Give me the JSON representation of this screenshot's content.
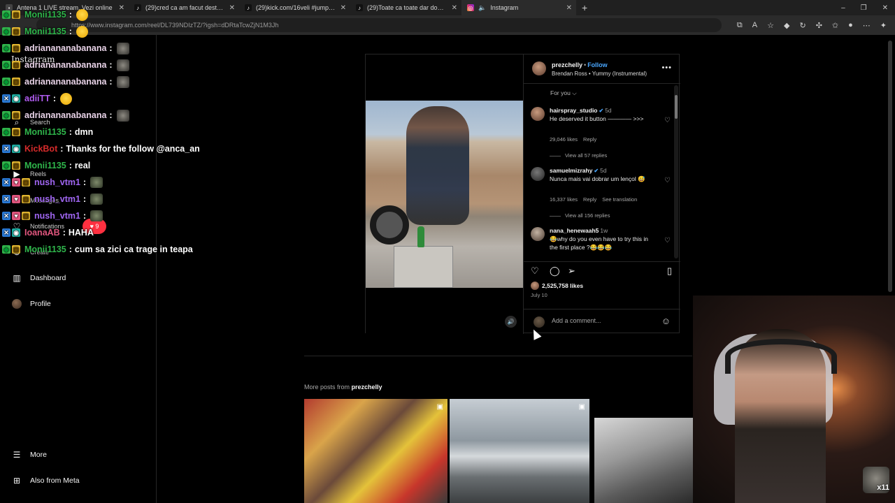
{
  "browser": {
    "tabs": [
      {
        "title": "Antena 1 LIVE stream. Vezi online",
        "icon": "page-icon",
        "active": false
      },
      {
        "title": "(29)cred ca am facut destul de cl",
        "icon": "tiktok-icon",
        "active": false
      },
      {
        "title": "(29)kick.com/16veli #jumpscare #",
        "icon": "tiktok-icon",
        "active": false
      },
      {
        "title": "(29)Toate ca toate dar domnu Jag",
        "icon": "tiktok-icon",
        "active": false
      },
      {
        "title": "Instagram",
        "icon": "instagram-icon",
        "active": true
      }
    ],
    "new_tab": "+",
    "url": "https://www.instagram.com/reel/DL739NDIzTZ/?igsh=dDRtaTcwZjN1M3Jh",
    "window_controls": [
      "–",
      "❐",
      "✕"
    ]
  },
  "sidebar": {
    "logo": "Instagram",
    "items": {
      "search": "Search",
      "reels": "Reels",
      "messages": "Messages",
      "notifications": "Notifications",
      "create": "Create",
      "dashboard": "Dashboard",
      "profile": "Profile",
      "more": "More",
      "also_from_meta": "Also from Meta"
    },
    "notification_badge": "9"
  },
  "chat": [
    {
      "user": "Monii1135",
      "color": "#2fb64b",
      "msg": "",
      "emote": "smile",
      "badges": [
        "green",
        "gold"
      ]
    },
    {
      "user": "Monii1135",
      "color": "#2fb64b",
      "msg": "",
      "emote": "smile",
      "badges": [
        "green",
        "gold"
      ]
    },
    {
      "user": "adrianananabanana",
      "color": "#e9d3e8",
      "msg": "",
      "emote": "monkey",
      "badges": [
        "green",
        "gold"
      ]
    },
    {
      "user": "adrianananabanana",
      "color": "#e9d3e8",
      "msg": "",
      "emote": "monkey",
      "badges": [
        "green",
        "gold"
      ]
    },
    {
      "user": "adrianananabanana",
      "color": "#e9d3e8",
      "msg": "",
      "emote": "monkey",
      "badges": [
        "green",
        "gold"
      ]
    },
    {
      "user": "adiiTT",
      "color": "#b05cf0",
      "msg": "",
      "emote": "smile",
      "badges": [
        "blue",
        "teal"
      ]
    },
    {
      "user": "adrianananabanana",
      "color": "#e9d3e8",
      "msg": "",
      "emote": "monkey",
      "badges": [
        "green",
        "gold"
      ]
    },
    {
      "user": "Monii1135",
      "color": "#2fb64b",
      "msg": "dmn",
      "emote": "",
      "badges": [
        "green",
        "gold"
      ]
    },
    {
      "user": "KickBot",
      "color": "#d62b2b",
      "msg": "Thanks for the follow @anca_an",
      "emote": "",
      "badges": [
        "blue",
        "teal"
      ]
    },
    {
      "user": "Monii1135",
      "color": "#2fb64b",
      "msg": "real",
      "emote": "",
      "badges": [
        "green",
        "gold"
      ]
    },
    {
      "user": "nush_vtm1",
      "color": "#a066f2",
      "msg": "",
      "emote": "frog",
      "badges": [
        "blue",
        "pink",
        "gold"
      ]
    },
    {
      "user": "nush_vtm1",
      "color": "#a066f2",
      "msg": "",
      "emote": "frog",
      "badges": [
        "blue",
        "pink",
        "gold"
      ]
    },
    {
      "user": "nush_vtm1",
      "color": "#a066f2",
      "msg": "",
      "emote": "frog",
      "badges": [
        "blue",
        "pink",
        "gold"
      ]
    },
    {
      "user": "IoanaAB",
      "color": "#e0567e",
      "msg": "HAHA",
      "emote": "",
      "badges": [
        "blue",
        "teal"
      ]
    },
    {
      "user": "Monii1135",
      "color": "#2fb64b",
      "msg": "cum sa zici ca trage in teapa",
      "emote": "",
      "badges": [
        "green",
        "gold"
      ]
    }
  ],
  "post": {
    "author": "prezchelly",
    "follow": "Follow",
    "audio": "Brendan Ross • Yummy (Instrumental)",
    "for_you": "For you",
    "comments": [
      {
        "user": "hairspray_studio",
        "time": "5d",
        "text": "He deserved it button ———— >>>",
        "likes": "29,046 likes",
        "reply": "Reply",
        "translation": "",
        "replies": "View all 57 replies"
      },
      {
        "user": "samuelmizrahy",
        "time": "5d",
        "text": "Nunca mais vai dobrar um lençol 😅",
        "likes": "16,337 likes",
        "reply": "Reply",
        "translation": "See translation",
        "replies": "View all 156 replies"
      },
      {
        "user": "nana_henewaah5",
        "time": "1w",
        "text": "😂why do you even have to try this in the first place ?😂😂😂",
        "likes": "",
        "reply": "",
        "translation": "",
        "replies": ""
      }
    ],
    "likes": "2,525,758 likes",
    "date": "July 10",
    "add_comment": "Add a comment..."
  },
  "more_posts": {
    "prefix": "More posts from",
    "user": "prezchelly"
  },
  "webcam": {
    "emote_count": "x11"
  }
}
